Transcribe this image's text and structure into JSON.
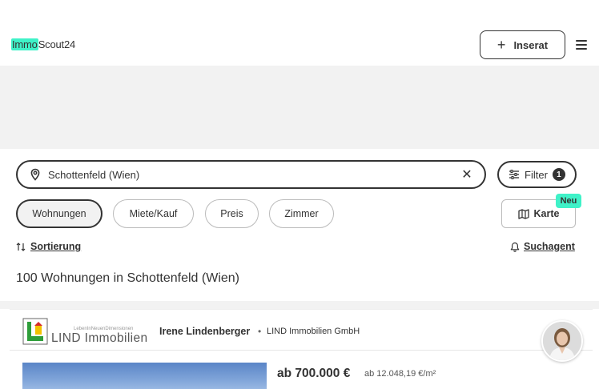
{
  "header": {
    "logo_part1": "Immo",
    "logo_part2": "Scout24",
    "inserat_label": "Inserat",
    "accent_color": "#3ff2c8"
  },
  "search": {
    "location_value": "Schottenfeld (Wien)",
    "filter_label": "Filter",
    "filter_count": "1"
  },
  "chips": [
    {
      "label": "Wohnungen",
      "active": true
    },
    {
      "label": "Miete/Kauf",
      "active": false
    },
    {
      "label": "Preis",
      "active": false
    },
    {
      "label": "Zimmer",
      "active": false
    }
  ],
  "map": {
    "label": "Karte",
    "badge": "Neu"
  },
  "toolbar": {
    "sort_label": "Sortierung",
    "search_agent_label": "Suchagent"
  },
  "results": {
    "count_text": "100 Wohnungen in Schottenfeld (Wien)"
  },
  "listing": {
    "agency_logo_text": "LIND Immobilien",
    "agency_logo_tagline": "LebenInNeuenDimensionen",
    "agent_name": "Irene Lindenberger",
    "separator": "•",
    "agency_name": "LIND Immobilien GmbH",
    "price": "ab 700.000 €",
    "price_per_sqm": "ab 12.048,19 €/m²"
  }
}
